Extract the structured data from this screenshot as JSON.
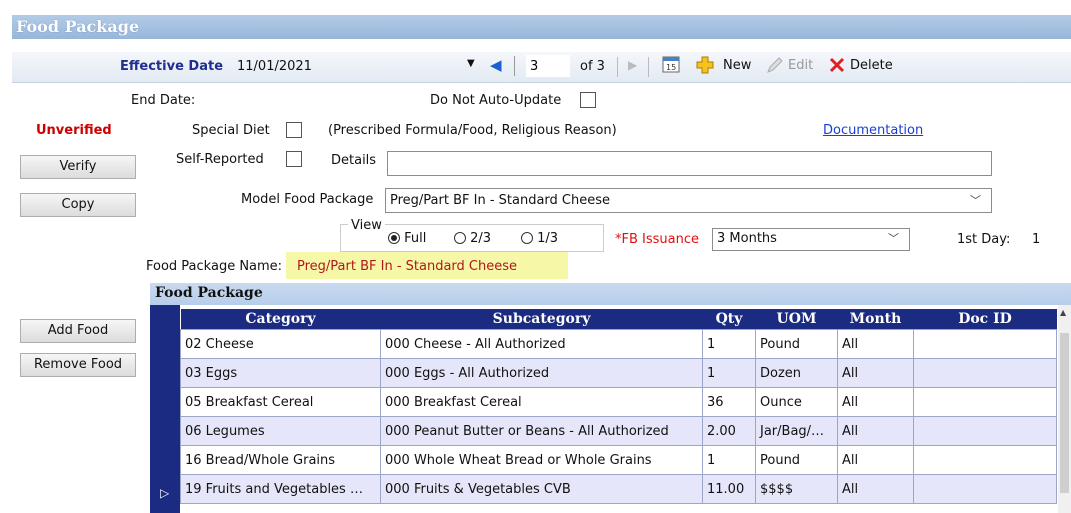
{
  "window": {
    "title": "Food Package"
  },
  "toolbar": {
    "effective_date_label": "Effective Date",
    "effective_date_value": "11/01/2021",
    "record_index": "3",
    "record_total": "of 3",
    "new_label": "New",
    "edit_label": "Edit",
    "delete_label": "Delete"
  },
  "form": {
    "end_date_label": "End Date:",
    "do_not_auto_update_label": "Do Not Auto-Update",
    "status": "Unverified",
    "special_diet_label": "Special Diet",
    "special_diet_note": "(Prescribed Formula/Food, Religious Reason)",
    "documentation_link": "Documentation",
    "self_reported_label": "Self-Reported",
    "details_label": "Details",
    "details_value": "",
    "model_food_package_label": "Model Food Package",
    "model_food_package_value": "Preg/Part BF In - Standard Cheese",
    "view_label": "View",
    "view_options": [
      "Full",
      "2/3",
      "1/3"
    ],
    "view_selected": "Full",
    "fb_issuance_label": "*FB Issuance",
    "fb_issuance_value": "3 Months",
    "first_day_label": "1st Day:",
    "first_day_value": "1",
    "food_package_name_label": "Food Package Name:",
    "food_package_name_value": "Preg/Part BF In - Standard Cheese"
  },
  "side_buttons": {
    "verify": "Verify",
    "copy": "Copy",
    "add_food": "Add Food",
    "remove_food": "Remove Food"
  },
  "grid": {
    "caption": "Food Package",
    "columns": [
      "Category",
      "Subcategory",
      "Qty",
      "UOM",
      "Month",
      "Doc ID"
    ],
    "rows": [
      {
        "category": "02 Cheese",
        "subcategory": "000 Cheese - All Authorized",
        "qty": "1",
        "uom": "Pound",
        "month": "All",
        "doc_id": ""
      },
      {
        "category": "03 Eggs",
        "subcategory": "000 Eggs - All Authorized",
        "qty": "1",
        "uom": "Dozen",
        "month": "All",
        "doc_id": ""
      },
      {
        "category": "05 Breakfast Cereal",
        "subcategory": "000 Breakfast Cereal",
        "qty": "36",
        "uom": "Ounce",
        "month": "All",
        "doc_id": ""
      },
      {
        "category": "06 Legumes",
        "subcategory": "000 Peanut Butter or Beans - All Authorized",
        "qty": "2.00",
        "uom": "Jar/Bag/…",
        "month": "All",
        "doc_id": ""
      },
      {
        "category": "16 Bread/Whole Grains",
        "subcategory": "000 Whole Wheat Bread or Whole Grains",
        "qty": "1",
        "uom": "Pound",
        "month": "All",
        "doc_id": ""
      },
      {
        "category": "19 Fruits and Vegetables …",
        "subcategory": "000 Fruits & Vegetables CVB",
        "qty": "11.00",
        "uom": "$$$$",
        "month": "All",
        "doc_id": ""
      }
    ]
  },
  "colors": {
    "title_bar": "#a9c3e2",
    "grid_header": "#1c2b82",
    "status_red": "#cc0000",
    "highlight": "#f7f7a8"
  }
}
